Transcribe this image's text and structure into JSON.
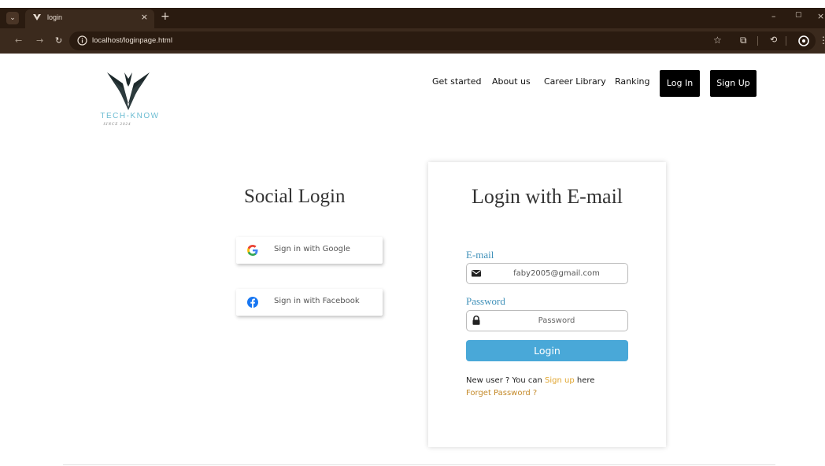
{
  "browser": {
    "tab_list_icon": "chevron-down-icon",
    "tab_title": "login",
    "tab_close": "×",
    "new_tab": "+",
    "url": "localhost/loginpage.html",
    "icons": [
      "back-icon",
      "forward-icon",
      "reload-icon",
      "info-icon",
      "star-icon",
      "extensions-icon",
      "history-icon",
      "profile-icon",
      "menu-icon"
    ],
    "window_controls": [
      "minimize-icon",
      "restore-icon",
      "close-icon"
    ]
  },
  "site": {
    "logo_text": "TECH-KNOW",
    "logo_since": "SINCE 2024",
    "nav": [
      "Get started",
      "About us",
      "Career Library",
      "Ranking"
    ],
    "login_button": "Log In",
    "signup_button": "Sign Up"
  },
  "social": {
    "title": "Social Login",
    "google_label": "Sign in with Google",
    "facebook_label": "Sign in with Facebook"
  },
  "email_login": {
    "title": "Login with E-mail",
    "email_label": "E-mail",
    "email_value": "faby2005@gmail.com",
    "password_label": "Password",
    "password_placeholder": "Password",
    "login_button": "Login",
    "new_user_prefix": "New user ? You can ",
    "signup_link": "Sign up",
    "new_user_suffix": " here",
    "forget_password": "Forget Password ?"
  },
  "colors": {
    "chrome_dark": "#2a1b10",
    "chrome_bar": "#3b2a1d",
    "accent_blue": "#49a8d8",
    "label_blue": "#3d8fb8",
    "link_orange": "#e0a52f",
    "logo_teal": "#6bbcd2"
  }
}
